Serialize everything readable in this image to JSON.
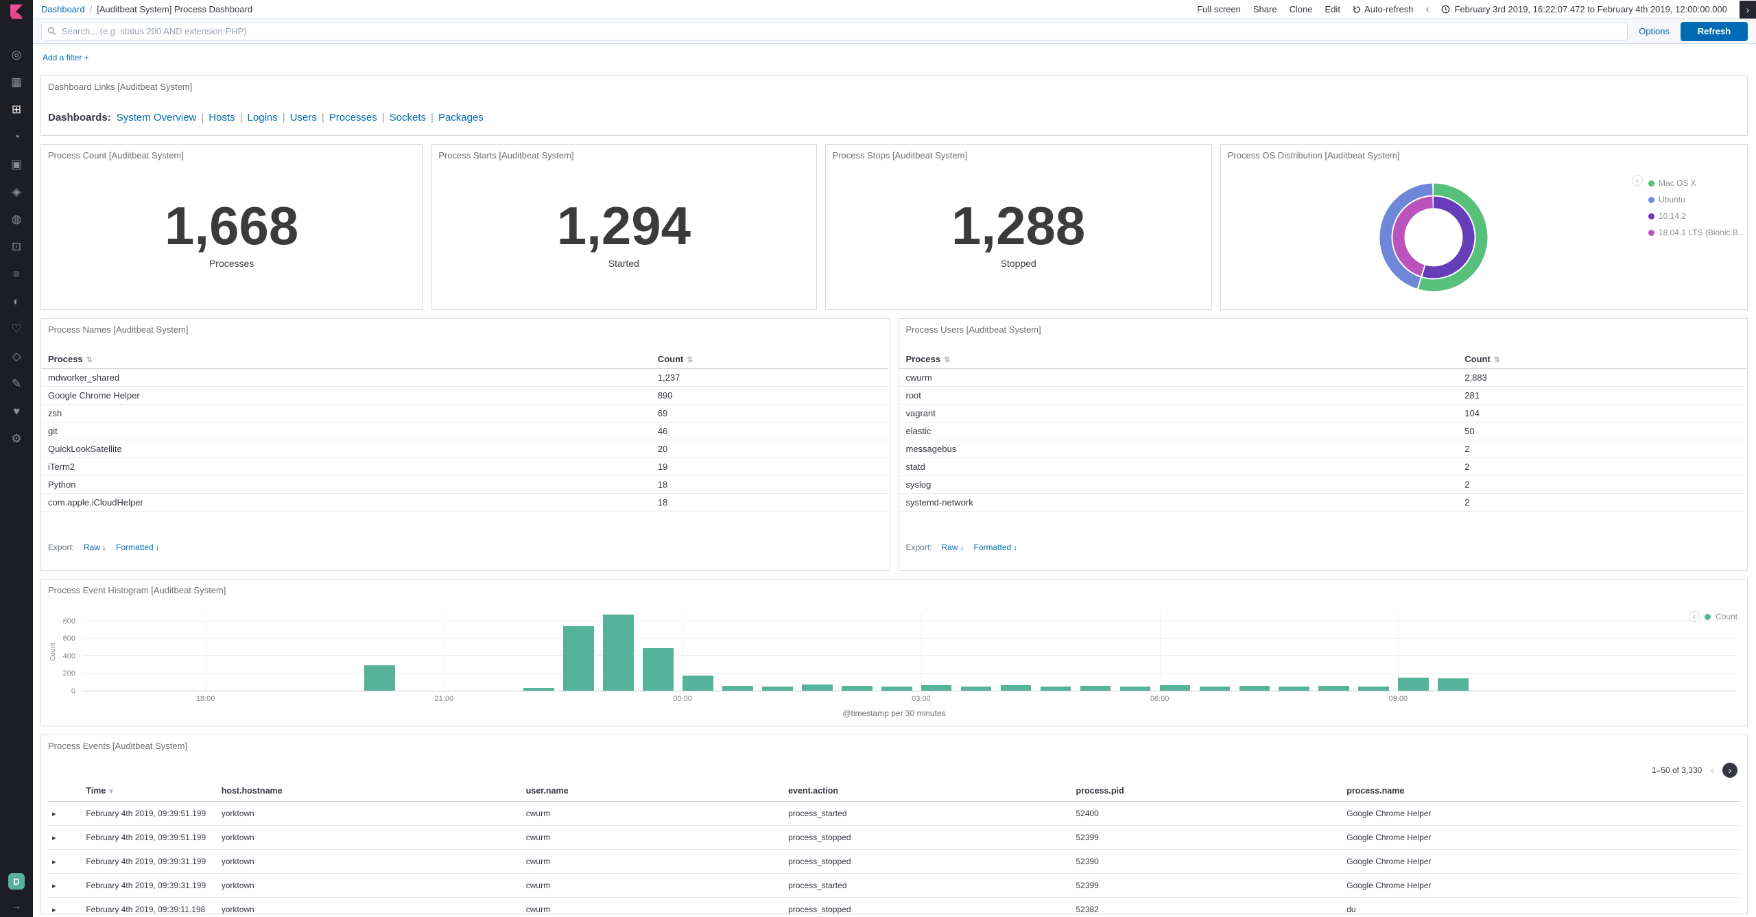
{
  "icons": {
    "chevron_left": "‹",
    "chevron_right": "›",
    "caret_right": "▸",
    "caret_down": "▾",
    "sort": "⇅",
    "download": "↓",
    "arrow_expand": "→"
  },
  "topnav": {
    "breadcrumb": {
      "root": "Dashboard",
      "separator": "/",
      "current": "[Auditbeat System] Process Dashboard"
    },
    "actions": [
      "Full screen",
      "Share",
      "Clone",
      "Edit"
    ],
    "auto_refresh_label": "Auto-refresh",
    "time_range": "February 3rd 2019, 16:22:07.472 to February 4th 2019, 12:00:00.000"
  },
  "querybar": {
    "placeholder": "Search... (e.g. status:200 AND extension:PHP)",
    "options_label": "Options",
    "refresh_label": "Refresh"
  },
  "filterbar": {
    "add_filter_label": "Add a filter +"
  },
  "sidebar": {
    "space_initial": "D",
    "space_color": "#54B399",
    "items": [
      {
        "name": "discover",
        "glyph": "◎",
        "active": false
      },
      {
        "name": "visualize",
        "glyph": "▦",
        "active": false
      },
      {
        "name": "dashboard",
        "glyph": "⊞",
        "active": true
      },
      {
        "name": "timelion",
        "glyph": "◔",
        "active": false
      },
      {
        "name": "canvas",
        "glyph": "▣",
        "active": false
      },
      {
        "name": "maps",
        "glyph": "◈",
        "active": false
      },
      {
        "name": "machine-learning",
        "glyph": "◍",
        "active": false
      },
      {
        "name": "infrastructure",
        "glyph": "⊡",
        "active": false
      },
      {
        "name": "logs",
        "glyph": "≡",
        "active": false
      },
      {
        "name": "apm",
        "glyph": "◐",
        "active": false
      },
      {
        "name": "uptime",
        "glyph": "♡",
        "active": false
      },
      {
        "name": "graph",
        "glyph": "◇",
        "active": false
      },
      {
        "name": "dev-tools",
        "glyph": "✎",
        "active": false
      },
      {
        "name": "monitoring",
        "glyph": "♥",
        "active": false
      },
      {
        "name": "management",
        "glyph": "⚙",
        "active": false
      }
    ]
  },
  "panels": {
    "links": {
      "title": "Dashboard Links [Auditbeat System]",
      "label": "Dashboards:",
      "separator": "|",
      "items": [
        "System Overview",
        "Hosts",
        "Logins",
        "Users",
        "Processes",
        "Sockets",
        "Packages"
      ]
    },
    "count": {
      "title": "Process Count [Auditbeat System]",
      "value": "1,668",
      "label": "Processes"
    },
    "starts": {
      "title": "Process Starts [Auditbeat System]",
      "value": "1,294",
      "label": "Started"
    },
    "stops": {
      "title": "Process Stops [Auditbeat System]",
      "value": "1,288",
      "label": "Stopped"
    },
    "os": {
      "title": "Process OS Distribution [Auditbeat System]",
      "legend": [
        {
          "label": "Mac OS X",
          "color": "#57C17B"
        },
        {
          "label": "Ubuntu",
          "color": "#6F87D8"
        },
        {
          "label": "10.14.2",
          "color": "#663DB8"
        },
        {
          "label": "18.04.1 LTS (Bionic B...",
          "color": "#BC52BC"
        }
      ]
    },
    "names": {
      "title": "Process Names [Auditbeat System]",
      "columns": [
        "Process",
        "Count"
      ],
      "rows": [
        [
          "mdworker_shared",
          "1,237"
        ],
        [
          "Google Chrome Helper",
          "890"
        ],
        [
          "zsh",
          "69"
        ],
        [
          "git",
          "46"
        ],
        [
          "QuickLookSatellite",
          "20"
        ],
        [
          "iTerm2",
          "19"
        ],
        [
          "Python",
          "18"
        ],
        [
          "com.apple.iCloudHelper",
          "18"
        ]
      ],
      "export_label": "Export:",
      "export_links": [
        "Raw",
        "Formatted"
      ]
    },
    "users": {
      "title": "Process Users [Auditbeat System]",
      "columns": [
        "Process",
        "Count"
      ],
      "rows": [
        [
          "cwurm",
          "2,883"
        ],
        [
          "root",
          "281"
        ],
        [
          "vagrant",
          "104"
        ],
        [
          "elastic",
          "50"
        ],
        [
          "messagebus",
          "2"
        ],
        [
          "statd",
          "2"
        ],
        [
          "syslog",
          "2"
        ],
        [
          "systemd-network",
          "2"
        ]
      ],
      "export_label": "Export:",
      "export_links": [
        "Raw",
        "Formatted"
      ]
    },
    "histogram": {
      "title": "Process Event Histogram [Auditbeat System]",
      "legend_label": "Count"
    },
    "events": {
      "title": "Process Events [Auditbeat System]",
      "pagination": "1–50 of 3,330",
      "columns": [
        "Time",
        "host.hostname",
        "user.name",
        "event.action",
        "process.pid",
        "process.name"
      ],
      "rows": [
        [
          "February 4th 2019, 09:39:51.199",
          "yorktown",
          "cwurm",
          "process_started",
          "52400",
          "Google Chrome Helper"
        ],
        [
          "February 4th 2019, 09:39:51.199",
          "yorktown",
          "cwurm",
          "process_stopped",
          "52399",
          "Google Chrome Helper"
        ],
        [
          "February 4th 2019, 09:39:31.199",
          "yorktown",
          "cwurm",
          "process_stopped",
          "52390",
          "Google Chrome Helper"
        ],
        [
          "February 4th 2019, 09:39:31.199",
          "yorktown",
          "cwurm",
          "process_started",
          "52399",
          "Google Chrome Helper"
        ],
        [
          "February 4th 2019, 09:39:11.198",
          "yorktown",
          "cwurm",
          "process_stopped",
          "52382",
          "du"
        ]
      ]
    }
  },
  "chart_data": [
    {
      "type": "pie",
      "donut": true,
      "title": "Process OS Distribution [Auditbeat System]",
      "legend_position": "right",
      "rings": [
        {
          "name": "os.name",
          "slices": [
            {
              "label": "Mac OS X",
              "pct": 55,
              "color": "#57C17B"
            },
            {
              "label": "Ubuntu",
              "pct": 45,
              "color": "#6F87D8"
            }
          ]
        },
        {
          "name": "os.version",
          "slices": [
            {
              "label": "10.14.2",
              "pct": 55,
              "color": "#663DB8"
            },
            {
              "label": "18.04.1 LTS (Bionic B...",
              "pct": 45,
              "color": "#BC52BC"
            }
          ]
        }
      ]
    },
    {
      "type": "bar",
      "title": "Process Event Histogram [Auditbeat System]",
      "xlabel": "@timestamp per 30 minutes",
      "ylabel": "Count",
      "legend_position": "top-right",
      "grid": true,
      "x_domain_hours": [
        16.45,
        37.25
      ],
      "bucket_hours": 0.5,
      "ylim": [
        0,
        900
      ],
      "yticks": [
        0,
        200,
        400,
        600,
        800
      ],
      "xticks": [
        {
          "t": 18,
          "label": "18:00"
        },
        {
          "t": 21,
          "label": "21:00"
        },
        {
          "t": 24,
          "label": "00:00"
        },
        {
          "t": 27,
          "label": "03:00"
        },
        {
          "t": 30,
          "label": "06:00"
        },
        {
          "t": 33,
          "label": "09:00"
        }
      ],
      "series": [
        {
          "name": "Count",
          "color": "#54B399",
          "points": [
            [
              20.0,
              290
            ],
            [
              22.0,
              30
            ],
            [
              22.5,
              740
            ],
            [
              23.0,
              880
            ],
            [
              23.5,
              490
            ],
            [
              24.0,
              170
            ],
            [
              24.5,
              55
            ],
            [
              25.0,
              45
            ],
            [
              25.5,
              70
            ],
            [
              26.0,
              55
            ],
            [
              26.5,
              50
            ],
            [
              27.0,
              65
            ],
            [
              27.5,
              50
            ],
            [
              28.0,
              60
            ],
            [
              28.5,
              45
            ],
            [
              29.0,
              55
            ],
            [
              29.5,
              50
            ],
            [
              30.0,
              60
            ],
            [
              30.5,
              50
            ],
            [
              31.0,
              55
            ],
            [
              31.5,
              45
            ],
            [
              32.0,
              55
            ],
            [
              32.5,
              50
            ],
            [
              33.0,
              150
            ],
            [
              33.5,
              140
            ]
          ]
        }
      ]
    }
  ]
}
